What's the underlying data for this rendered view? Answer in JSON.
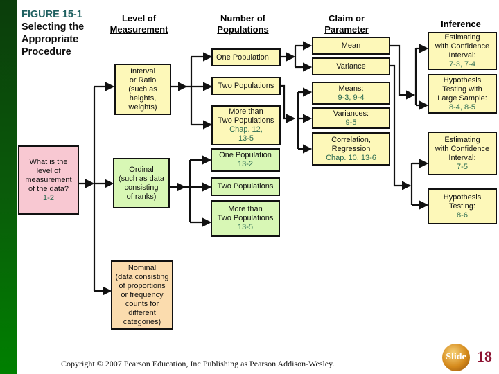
{
  "figure": {
    "label": "FIGURE 15-1",
    "title_lines": [
      "Selecting the",
      "Appropriate",
      "Procedure"
    ]
  },
  "columns": {
    "level": [
      "Level of",
      "Measurement"
    ],
    "populations": [
      "Number of",
      "Populations"
    ],
    "claim": [
      "Claim  or",
      "Parameter"
    ],
    "inference": [
      "Inference"
    ]
  },
  "nodes": {
    "question": {
      "text": [
        "What is the",
        "level of",
        "measurement",
        "of the data?"
      ],
      "ref": "1-2"
    },
    "interval": {
      "text": [
        "Interval",
        "or Ratio",
        "(such as",
        "heights,",
        "weights)"
      ]
    },
    "ordinal": {
      "text": [
        "Ordinal",
        "(such as data",
        "consisting",
        "of  ranks)"
      ]
    },
    "nominal": {
      "text": [
        "Nominal",
        "(data consisting",
        "of proportions",
        "or frequency",
        "counts for",
        "different",
        "categories)"
      ]
    },
    "int_one_pop": {
      "text": [
        "One Population"
      ]
    },
    "int_two_pop": {
      "text": [
        "Two Populations"
      ]
    },
    "int_more_pop": {
      "text": [
        "More than",
        "Two Populations"
      ],
      "ref": [
        "Chap. 12,",
        "13-5"
      ]
    },
    "ord_one_pop": {
      "text": [
        "One Population"
      ],
      "ref": "13-2"
    },
    "ord_two_pop": {
      "text": [
        "Two Populations"
      ]
    },
    "ord_more_pop": {
      "text": [
        "More than",
        "Two Populations"
      ],
      "ref": "13-5"
    },
    "mean": {
      "text": [
        "Mean"
      ]
    },
    "variance": {
      "text": [
        "Variance"
      ]
    },
    "means": {
      "text": [
        "Means:"
      ],
      "ref": "9-3, 9-4"
    },
    "variances": {
      "text": [
        "Variances:"
      ],
      "ref": "9-5"
    },
    "correlation": {
      "text": [
        "Correlation,",
        "Regression"
      ],
      "ref": "Chap. 10,  13-6"
    },
    "est_ci_1": {
      "text": [
        "Estimating",
        "with Confidence",
        "Interval:"
      ],
      "ref": "7-3, 7-4"
    },
    "hyp_large": {
      "text": [
        "Hypothesis",
        "Testing with",
        "Large Sample:"
      ],
      "ref": "8-4, 8-5"
    },
    "est_ci_2": {
      "text": [
        "Estimating",
        "with Confidence",
        "Interval:"
      ],
      "ref": "7-5"
    },
    "hyp_test": {
      "text": [
        "Hypothesis",
        "Testing:"
      ],
      "ref": "8-6"
    }
  },
  "footer": {
    "copyright": "Copyright © 2007 Pearson Education, Inc Publishing as Pearson Addison-Wesley.",
    "slide_label": "Slide",
    "slide_number": "18"
  },
  "colors": {
    "yellow_box": "#fdf8b9",
    "green_box": "#d8f7b5",
    "pink_box": "#f8c8d2",
    "peach_box": "#fbdcae",
    "reference_text": "#2a6a50",
    "figure_label": "#1e6060",
    "slide_number": "#8c1030"
  }
}
